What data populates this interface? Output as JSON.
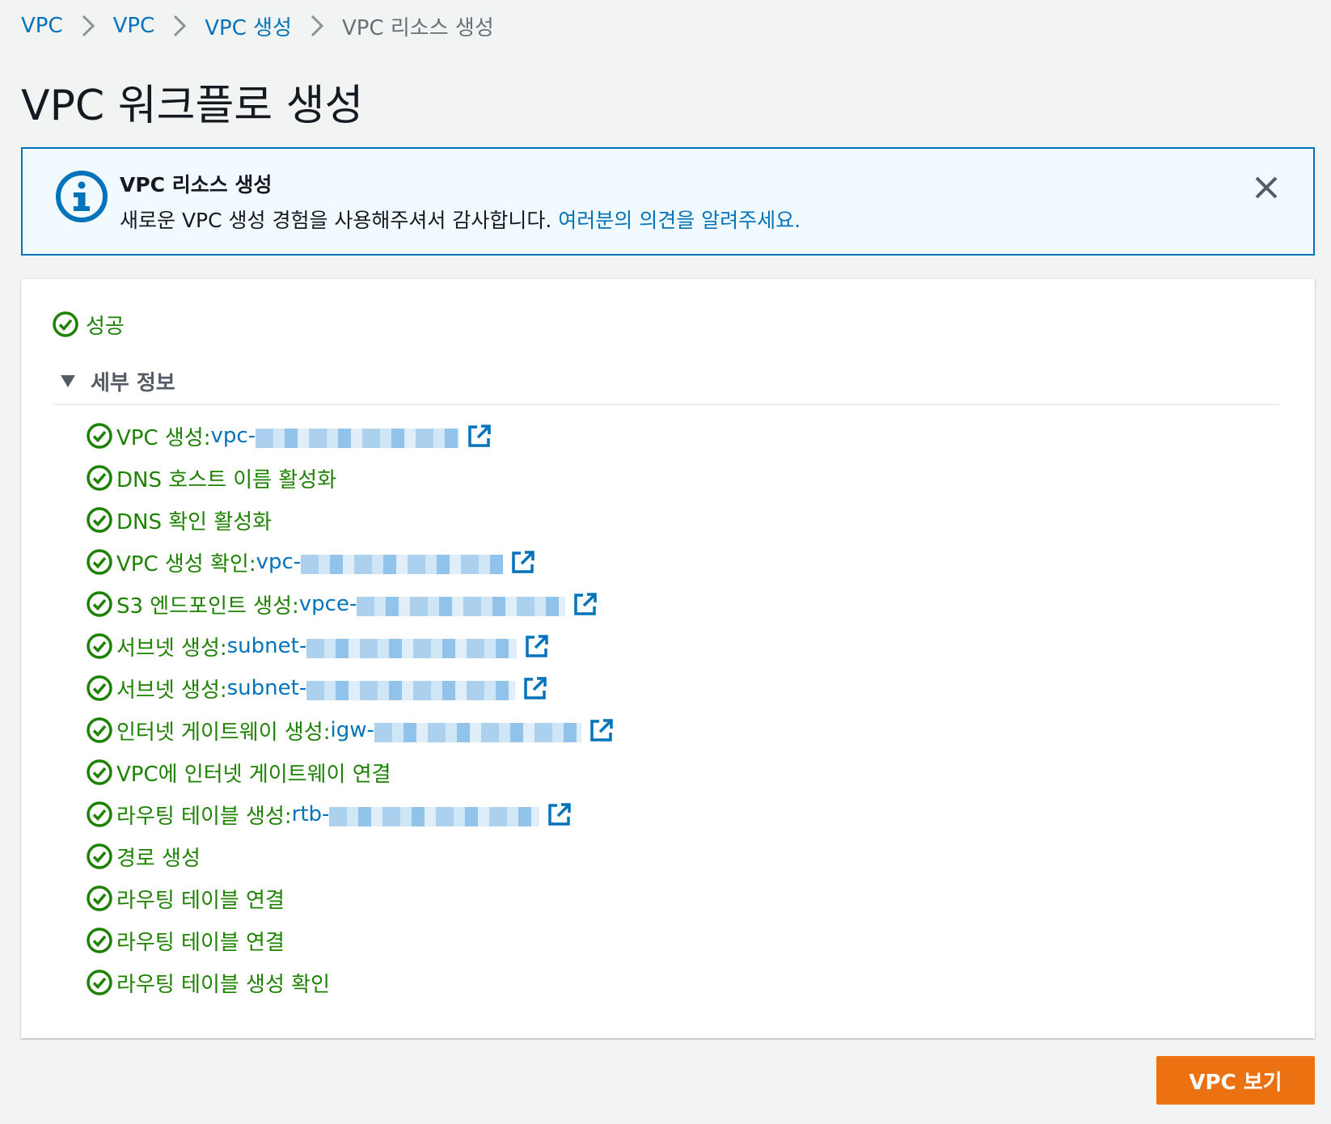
{
  "breadcrumb": {
    "items": [
      "VPC",
      "VPC",
      "VPC 생성"
    ],
    "current": "VPC 리소스 생성"
  },
  "page": {
    "title": "VPC 워크플로 생성"
  },
  "flash": {
    "title": "VPC 리소스 생성",
    "message": "새로운 VPC 생성 경험을 사용해주셔서 감사합니다. ",
    "link": "여러분의 의견을 알려주세요."
  },
  "status": {
    "label": "성공"
  },
  "details": {
    "title": "세부 정보",
    "steps": [
      {
        "label": "VPC 생성: ",
        "prefix": "vpc-"
      },
      {
        "label": "DNS 호스트 이름 활성화"
      },
      {
        "label": "DNS 확인 활성화"
      },
      {
        "label": "VPC 생성 확인: ",
        "prefix": "vpc-"
      },
      {
        "label": "S3 엔드포인트 생성: ",
        "prefix": "vpce-"
      },
      {
        "label": "서브넷 생성: ",
        "prefix": "subnet-"
      },
      {
        "label": "서브넷 생성: ",
        "prefix": "subnet-"
      },
      {
        "label": "인터넷 게이트웨이 생성: ",
        "prefix": "igw-"
      },
      {
        "label": "VPC에 인터넷 게이트웨이 연결"
      },
      {
        "label": "라우팅 테이블 생성: ",
        "prefix": "rtb-"
      },
      {
        "label": "경로 생성"
      },
      {
        "label": "라우팅 테이블 연결"
      },
      {
        "label": "라우팅 테이블 연결"
      },
      {
        "label": "라우팅 테이블 생성 확인"
      }
    ]
  },
  "actions": {
    "view_vpc": "VPC 보기"
  },
  "icons": {
    "breadcrumb_separator": "chevron-right-icon",
    "flash": "info-icon",
    "close": "close-icon",
    "status": "check-circle-icon",
    "expand": "caret-down-icon",
    "external_link": "external-link-icon"
  },
  "colors": {
    "link": "#0073bb",
    "success": "#1d8102",
    "primary_button": "#ec7211",
    "info_border": "#0073bb",
    "info_background": "#f1faff",
    "page_background": "#f2f3f3"
  }
}
